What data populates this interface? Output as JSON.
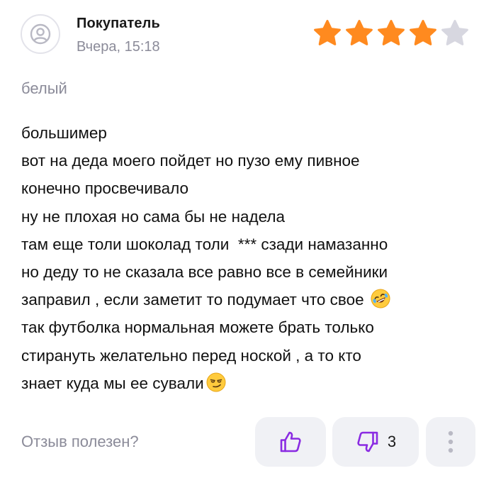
{
  "review": {
    "author": "Покупатель",
    "date": "Вчера, 15:18",
    "rating": 4,
    "rating_max": 5,
    "variant": "белый",
    "lines": [
      "большимер",
      "вот на деда моего пойдет но пузо ему пивное",
      "конечно просвечивало",
      "ну не плохая но сама бы не надела",
      "там еще толи шоколад толи  *** сзади намазанно",
      "но деду то не сказала все равно все в семейники",
      "заправил , если заметит то подумает что свое ",
      "так футболка нормальная можете брать только",
      "стирануть желательно перед ноской , а то кто",
      "знает куда мы ее сували"
    ]
  },
  "footer": {
    "helpful_label": "Отзыв полезен?",
    "dislike_count": "3"
  },
  "icons": {
    "avatar": "user-avatar-icon",
    "like": "thumbs-up-icon",
    "dislike": "thumbs-down-icon",
    "more": "more-vertical-icon",
    "emoji_1": "rofl-emoji",
    "emoji_2": "smirk-emoji"
  },
  "colors": {
    "star_filled": "#ff8a1f",
    "star_empty": "#d7d7e0",
    "accent": "#8a2be2",
    "muted_text": "#8b8b99",
    "button_bg": "#f0f1f5"
  }
}
